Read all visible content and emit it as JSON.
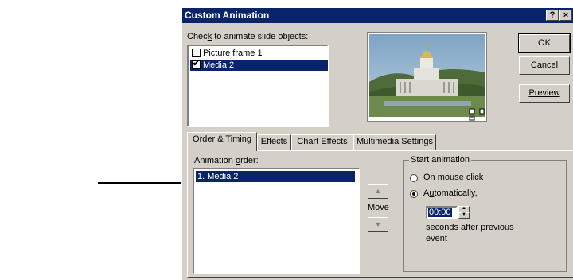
{
  "window": {
    "title": "Custom Animation",
    "help_label": "?",
    "close_label": "×"
  },
  "objects": {
    "label_pre": "Chec",
    "label_key": "k",
    "label_post": " to animate slide objects:",
    "items": [
      {
        "label": "Picture frame 1",
        "checked": false,
        "selected": false
      },
      {
        "label": "Media 2",
        "checked": true,
        "selected": true
      }
    ]
  },
  "buttons": {
    "ok": "OK",
    "cancel": "Cancel",
    "preview": "Preview"
  },
  "tabs": [
    {
      "label": "Order & Timing",
      "active": true
    },
    {
      "label": "Effects",
      "active": false
    },
    {
      "label": "Chart Effects",
      "active": false
    },
    {
      "label": "Multimedia Settings",
      "active": false
    }
  ],
  "order": {
    "label_pre": "Animation ",
    "label_key": "o",
    "label_post": "rder:",
    "items": [
      "1. Media 2"
    ],
    "move_label": "Move"
  },
  "start": {
    "group_label": "Start animation",
    "on_click_pre": "On ",
    "on_click_key": "m",
    "on_click_post": "ouse click",
    "auto_pre": "A",
    "auto_key": "u",
    "auto_post": "tomatically,",
    "selected": "automatically",
    "time_value": "00:00",
    "seconds_line1": "seconds after previous",
    "seconds_line2": "event"
  },
  "colors": {
    "face": "#d4d0c8",
    "title_bar": "#0a246a",
    "selection": "#0a246a"
  },
  "icons": [
    "help-icon",
    "close-icon",
    "checkmark-icon",
    "up-arrow-icon",
    "down-arrow-icon",
    "spin-up-icon",
    "spin-down-icon"
  ]
}
